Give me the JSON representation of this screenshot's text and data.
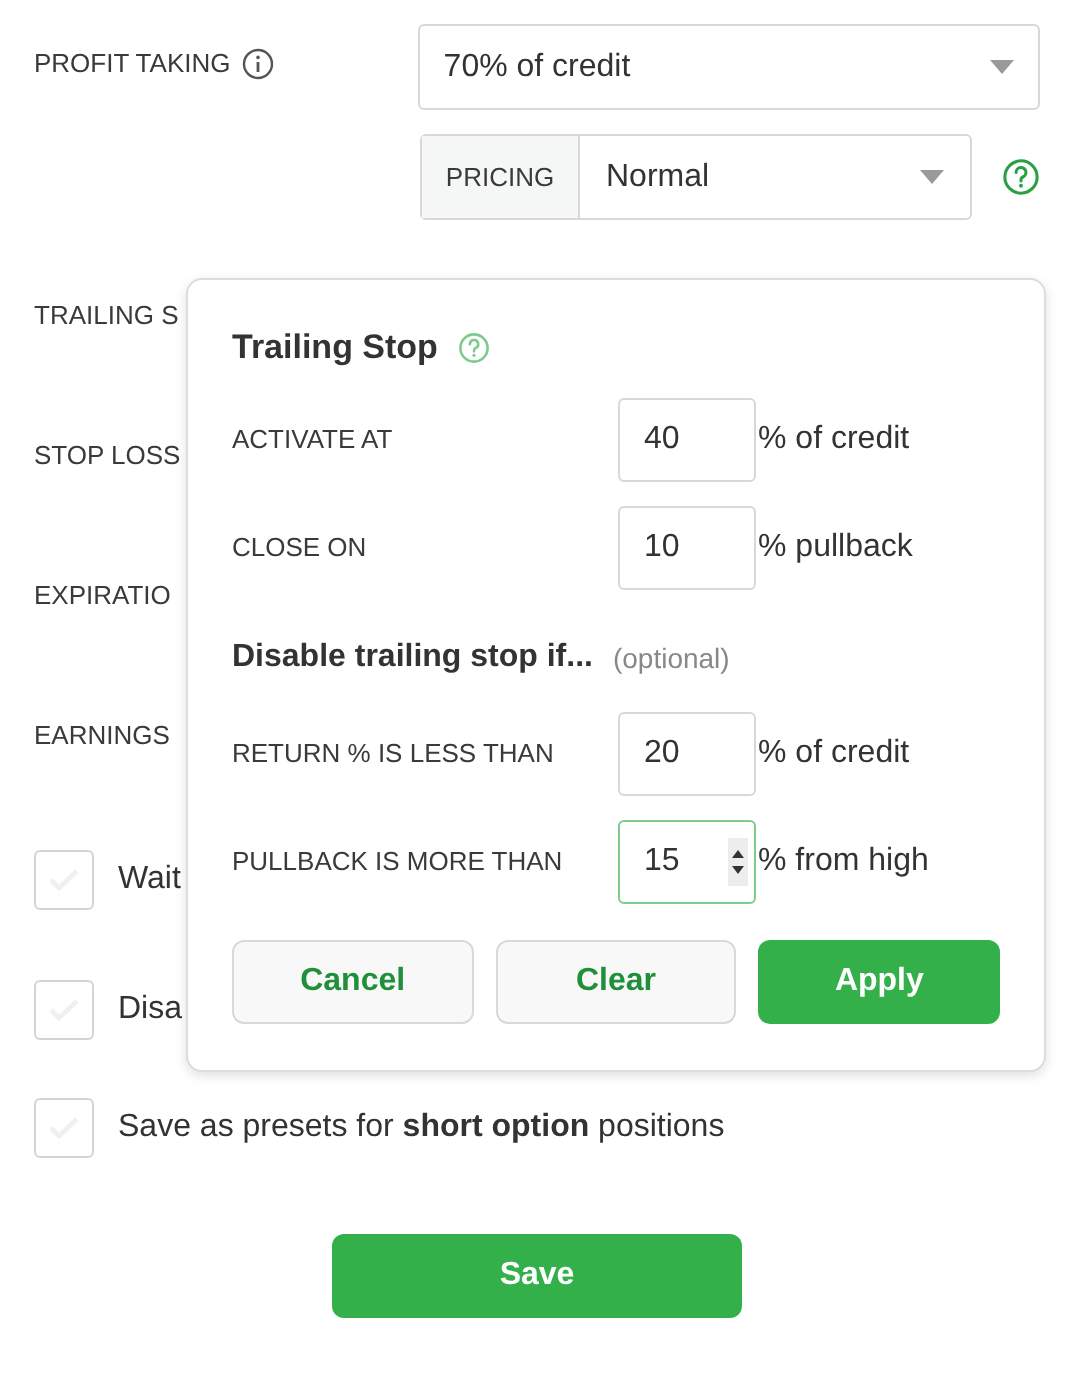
{
  "form": {
    "profit_taking": {
      "label": "PROFIT TAKING",
      "value": "70% of credit"
    },
    "pricing": {
      "label": "PRICING",
      "value": "Normal"
    },
    "rows": [
      {
        "label": "TRAILING S"
      },
      {
        "label": "STOP LOSS"
      },
      {
        "label": "EXPIRATIO"
      },
      {
        "label": "EARNINGS"
      }
    ],
    "checkboxes": [
      {
        "label": "Wait",
        "checked": false
      },
      {
        "label": "Disa",
        "checked": false
      },
      {
        "label": "Save as presets for **short option** positions",
        "checked": false
      }
    ],
    "save_button": "Save"
  },
  "popover": {
    "title": "Trailing Stop",
    "fields": [
      {
        "label": "ACTIVATE AT",
        "value": "40",
        "unit": "% of credit",
        "focused": false
      },
      {
        "label": "CLOSE ON",
        "value": "10",
        "unit": "% pullback",
        "focused": false
      }
    ],
    "section": {
      "title": "Disable trailing stop if...",
      "note": "(optional)"
    },
    "section_fields": [
      {
        "label": "RETURN % IS LESS THAN",
        "value": "20",
        "unit": "% of credit",
        "focused": false
      },
      {
        "label": "PULLBACK IS MORE THAN",
        "value": "15",
        "unit": "% from high",
        "focused": true
      }
    ],
    "buttons": [
      {
        "label": "Cancel",
        "kind": "secondary"
      },
      {
        "label": "Clear",
        "kind": "secondary"
      },
      {
        "label": "Apply",
        "kind": "primary"
      }
    ]
  }
}
